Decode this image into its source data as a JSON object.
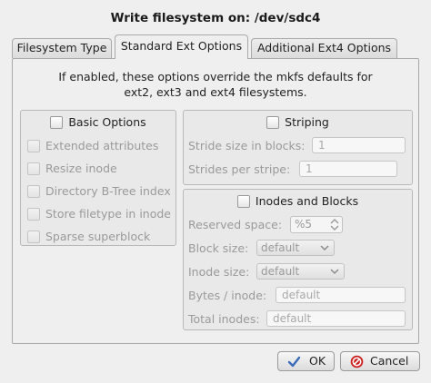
{
  "dialog": {
    "title": "Write filesystem on: /dev/sdc4"
  },
  "tabs": [
    {
      "label": "Filesystem Type",
      "active": false
    },
    {
      "label": "Standard Ext Options",
      "active": true
    },
    {
      "label": "Additional Ext4 Options",
      "active": false
    }
  ],
  "info": {
    "line1": "If enabled, these options override the mkfs defaults for",
    "line2": "ext2, ext3 and ext4 filesystems."
  },
  "basic": {
    "title": "Basic Options",
    "options": [
      "Extended attributes",
      "Resize inode",
      "Directory B-Tree index",
      "Store filetype in inode",
      "Sparse superblock"
    ]
  },
  "striping": {
    "title": "Striping",
    "stride_size_label": "Stride size in blocks:",
    "stride_size_value": "1",
    "strides_per_stripe_label": "Strides per stripe:",
    "strides_per_stripe_value": "1"
  },
  "inodes": {
    "title": "Inodes and Blocks",
    "reserved_label": "Reserved space:",
    "reserved_value": "%5",
    "block_size_label": "Block size:",
    "block_size_value": "default",
    "inode_size_label": "Inode size:",
    "inode_size_value": "default",
    "bytes_per_inode_label": "Bytes / inode:",
    "bytes_per_inode_placeholder": "default",
    "total_inodes_label": "Total inodes:",
    "total_inodes_placeholder": "default"
  },
  "buttons": {
    "ok": "OK",
    "cancel": "Cancel"
  },
  "colors": {
    "ok_icon": "#3a6cb8",
    "cancel_icon": "#cc1f1f"
  }
}
